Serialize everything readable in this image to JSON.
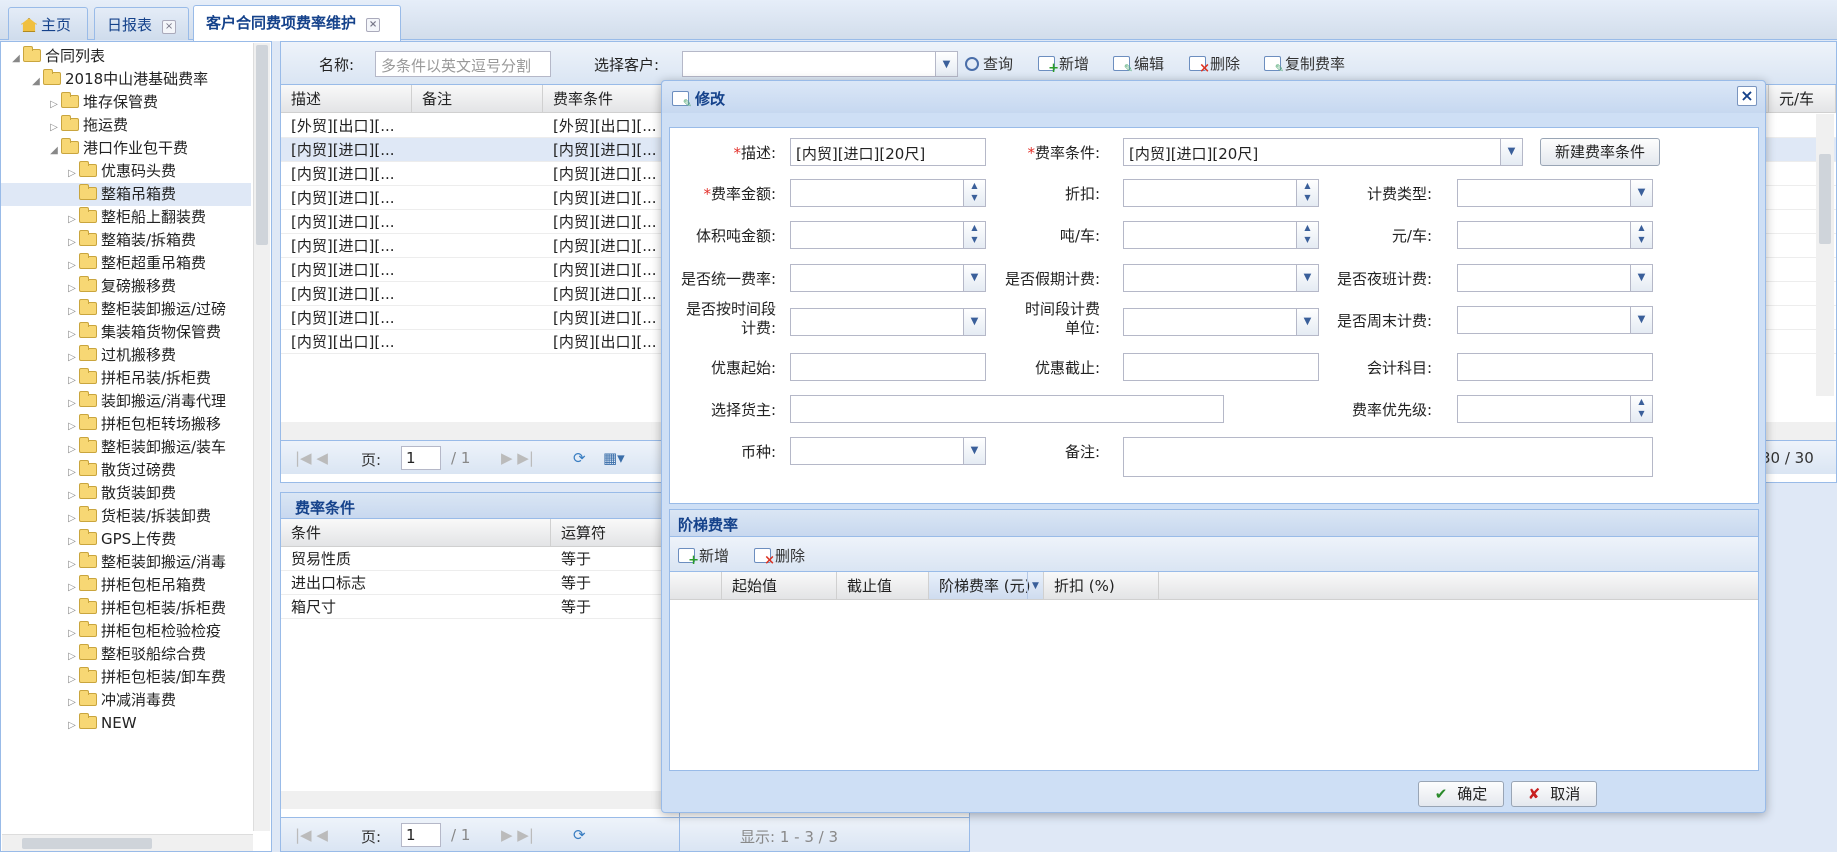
{
  "tabs": [
    {
      "label": "主页",
      "icon": "home-icon"
    },
    {
      "label": "日报表",
      "close": "×"
    },
    {
      "label": "客户合同费项费率维护",
      "close": "×"
    }
  ],
  "tree": {
    "root": "合同列表",
    "contract": "2018中山港基础费率",
    "items": [
      "堆存保管费",
      "拖运费",
      "港口作业包干费",
      "优惠码头费",
      "整箱吊箱费",
      "整柜船上翻装费",
      "整箱装/拆箱费",
      "整柜超重吊箱费",
      "复磅搬移费",
      "整柜装卸搬运/过磅",
      "集装箱货物保管费",
      "过机搬移费",
      "拼柜吊装/拆柜费",
      "装卸搬运/消毒代理",
      "拼柜包柜转场搬移",
      "整柜装卸搬运/装车",
      "散货过磅费",
      "散货装卸费",
      "货柜装/拆装卸费",
      "GPS上传费",
      "整柜装卸搬运/消毒",
      "拼柜包柜吊箱费",
      "拼柜包柜装/拆柜费",
      "拼柜包柜检验检疫",
      "整柜驳船综合费",
      "拼柜包柜装/卸车费",
      "冲减消毒费",
      "NEW"
    ]
  },
  "toolbar": {
    "name_label": "名称:",
    "name_placeholder": "多条件以英文逗号分割",
    "customer_label": "选择客户:",
    "query": "查询",
    "add": "新增",
    "edit": "编辑",
    "delete": "删除",
    "copy": "复制费率"
  },
  "grid": {
    "headers": [
      "描述",
      "备注",
      "费率条件",
      "元/车"
    ],
    "rows": [
      [
        "[外贸][出口][...",
        "",
        "[外贸][出口][..."
      ],
      [
        "[内贸][进口][...",
        "",
        "[内贸][进口][..."
      ],
      [
        "[内贸][进口][...",
        "",
        "[内贸][进口][..."
      ],
      [
        "[内贸][进口][...",
        "",
        "[内贸][进口][..."
      ],
      [
        "[内贸][进口][...",
        "",
        "[内贸][进口][..."
      ],
      [
        "[内贸][进口][...",
        "",
        "[内贸][进口][..."
      ],
      [
        "[内贸][进口][...",
        "",
        "[内贸][进口][..."
      ],
      [
        "[内贸][进口][...",
        "",
        "[内贸][进口][..."
      ],
      [
        "[内贸][进口][...",
        "",
        "[内贸][进口][..."
      ],
      [
        "[内贸][出口][...",
        "",
        "[内贸][出口][..."
      ]
    ],
    "pager": {
      "page_label": "页:",
      "page": "1",
      "of": "/ 1",
      "display": "30 / 30"
    }
  },
  "cond": {
    "title": "费率条件",
    "headers": [
      "条件",
      "运算符"
    ],
    "rows": [
      [
        "贸易性质",
        "等于"
      ],
      [
        "进出口标志",
        "等于"
      ],
      [
        "箱尺寸",
        "等于"
      ]
    ],
    "pager": {
      "page_label": "页:",
      "page": "1",
      "of": "/ 1",
      "display": "显示: 1 - 3 / 3"
    }
  },
  "modal": {
    "title": "修改",
    "close": "×",
    "req_mark": "*",
    "fields": {
      "desc_label": "描述:",
      "desc_value": "[内贸][进口][20尺]",
      "cond_label": "费率条件:",
      "cond_value": "[内贸][进口][20尺]",
      "new_cond_btn": "新建费率条件",
      "amount_label": "费率金额:",
      "discount_label": "折扣:",
      "billing_type_label": "计费类型:",
      "volume_label": "体积吨金额:",
      "ton_per_car_label": "吨/车:",
      "yuan_per_car_label": "元/车:",
      "unified_label": "是否统一费率:",
      "holiday_label": "是否假期计费:",
      "night_label": "是否夜班计费:",
      "time_period_label": "是否按时间段计费:",
      "time_unit_label": "时间段计费单位:",
      "weekend_label": "是否周末计费:",
      "promo_start_label": "优惠起始:",
      "promo_end_label": "优惠截止:",
      "account_label": "会计科目:",
      "shipper_label": "选择货主:",
      "priority_label": "费率优先级:",
      "currency_label": "币种:",
      "remark_label": "备注:"
    },
    "tier": {
      "title": "阶梯费率",
      "add": "新增",
      "delete": "删除",
      "headers": [
        "起始值",
        "截止值",
        "阶梯费率 (元)",
        "折扣 (%)"
      ]
    },
    "ok": "确定",
    "cancel": "取消"
  }
}
